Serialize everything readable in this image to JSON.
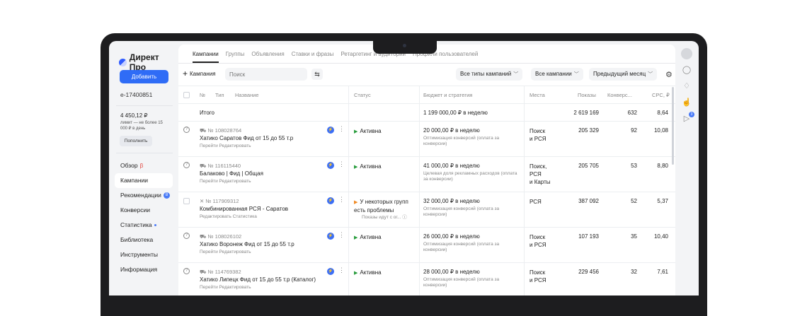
{
  "app": {
    "logo": "Директ Про"
  },
  "sidebar": {
    "add_label": "Добавить",
    "account": "e-17400851",
    "balance": "4 450,12 ₽",
    "limit": "лимит — не более 15 000 ₽ в день",
    "topup_label": "Пополнить",
    "nav": [
      {
        "label": "Обзор",
        "suffix": "β"
      },
      {
        "label": "Кампании"
      },
      {
        "label": "Рекомендации",
        "badge": "8"
      },
      {
        "label": "Конверсии"
      },
      {
        "label": "Статистика"
      },
      {
        "label": "Библиотека"
      },
      {
        "label": "Инструменты"
      },
      {
        "label": "Информация"
      }
    ]
  },
  "tabs": [
    "Кампании",
    "Группы",
    "Объявления",
    "Ставки и фразы",
    "Ретаргетинг и аудитории",
    "Профили пользователей"
  ],
  "toolbar": {
    "campaign_label": "Кампания",
    "search_placeholder": "Поиск",
    "type_filter": "Все типы кампаний",
    "campaign_filter": "Все кампании",
    "period_filter": "Предыдущий месяц"
  },
  "table": {
    "headers": {
      "num": "№",
      "type": "Тип",
      "name": "Название",
      "status": "Статус",
      "budget": "Бюджет и стратегия",
      "places": "Места",
      "shows": "Показы",
      "conv": "Конверс...",
      "cpc": "CPC, ₽"
    },
    "total": {
      "label": "Итого",
      "budget": "1 199 000,00 ₽ в неделю",
      "shows": "2 619 169",
      "conv": "632",
      "cpc": "8,64"
    },
    "rows": [
      {
        "num": "№ 108028764",
        "name": "Хатико Саратов Фид от 15 до 55 т.р",
        "links": "Перейти   Редактировать",
        "status": "Активна",
        "status_extra": "",
        "budget": "20 000,00 ₽ в неделю",
        "strategy": "Оптимизация конверсий (оплата за конверсии)",
        "places": "Поиск\nи РСЯ",
        "shows": "205 329",
        "conv": "92",
        "cpc": "10,08",
        "warn": false
      },
      {
        "num": "№ 116115440",
        "name": "Балаково | Фид | Общая",
        "links": "Перейти   Редактировать",
        "status": "Активна",
        "status_extra": "",
        "budget": "41 000,00 ₽ в неделю",
        "strategy": "Целевая доля рекламных расходов (оплата за конверсии)",
        "places": "Поиск,\nРСЯ\nи Карты",
        "shows": "205 705",
        "conv": "53",
        "cpc": "8,80",
        "warn": false
      },
      {
        "num": "№ 117909312",
        "name": "Комбинированная РСЯ - Саратов",
        "links": "Редактировать   Статистика",
        "status": "У некоторых групп есть проблемы",
        "status_extra": "Показы идут с ог...",
        "budget": "32 000,00 ₽ в неделю",
        "strategy": "Оптимизация конверсий (оплата за конверсии)",
        "places": "РСЯ",
        "shows": "387 092",
        "conv": "52",
        "cpc": "5,37",
        "warn": true
      },
      {
        "num": "№ 108026102",
        "name": "Хатико Воронеж Фид от 15 до 55 т.р",
        "links": "Перейти   Редактировать",
        "status": "Активна",
        "status_extra": "",
        "budget": "26 000,00 ₽ в неделю",
        "strategy": "Оптимизация конверсий (оплата за конверсии)",
        "places": "Поиск\nи РСЯ",
        "shows": "107 193",
        "conv": "35",
        "cpc": "10,40",
        "warn": false
      },
      {
        "num": "№ 114769382",
        "name": "Хатико Липецк Фид от 15 до 55 т.р (Каталог)",
        "links": "Перейти   Редактировать",
        "status": "Активна",
        "status_extra": "",
        "budget": "28 000,00 ₽ в неделю",
        "strategy": "Оптимизация конверсий (оплата за конверсии)",
        "places": "Поиск\nи РСЯ",
        "shows": "229 456",
        "conv": "32",
        "cpc": "7,61",
        "warn": false
      }
    ]
  },
  "icons": {
    "colors": {
      "accent": "#2f6cf6",
      "active": "#2a9d3e",
      "warning": "#f08a24"
    }
  }
}
